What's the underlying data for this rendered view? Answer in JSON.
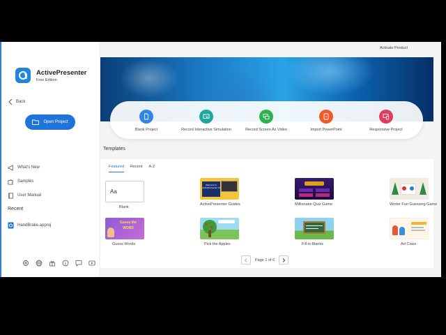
{
  "app": {
    "name": "ActivePresenter",
    "edition": "Free Edition",
    "activate": "Activate Product"
  },
  "sidebar": {
    "back": "Back",
    "open_project": "Open Project",
    "links": [
      {
        "label": "What's New",
        "icon": "megaphone-icon"
      },
      {
        "label": "Samples",
        "icon": "puzzle-icon"
      },
      {
        "label": "User Manual",
        "icon": "book-icon"
      }
    ],
    "recent_title": "Recent",
    "recent_items": [
      {
        "label": "HandBrake.approj",
        "icon": "project-file-icon"
      }
    ],
    "bottom_icons": [
      "settings-icon",
      "globe-icon",
      "gift-icon",
      "info-icon",
      "feedback-icon",
      "youtube-icon"
    ]
  },
  "actions": [
    {
      "label": "Blank Project",
      "color": "#2f86e4",
      "icon": "blank-file-icon"
    },
    {
      "label": "Record Interactive Simulation",
      "color": "#1fa8a0",
      "icon": "simulation-icon"
    },
    {
      "label": "Record Screen As Video",
      "color": "#2bb24c",
      "icon": "screen-record-icon"
    },
    {
      "label": "Import PowerPoint",
      "color": "#ef5a2a",
      "icon": "powerpoint-icon"
    },
    {
      "label": "Responsive Project",
      "color": "#e03d5e",
      "icon": "responsive-icon"
    }
  ],
  "templates": {
    "title": "Templates",
    "tabs": [
      {
        "label": "Featured",
        "active": true
      },
      {
        "label": "Recent",
        "active": false
      },
      {
        "label": "A-Z",
        "active": false
      }
    ],
    "blank_thumb_text": "Aa",
    "items": [
      {
        "name": "Blank"
      },
      {
        "name": "ActivePresenter Guides",
        "thumb_text": "Welcome to ActivePresenter 10"
      },
      {
        "name": "Millionaire Quiz Game"
      },
      {
        "name": "Winter Fun Guessing Game"
      },
      {
        "name": "Guess Words",
        "thumb_text": "Guess the WORD"
      },
      {
        "name": "Pick the Apples"
      },
      {
        "name": "Fill in Blanks"
      },
      {
        "name": "Art Class"
      }
    ],
    "pagination": "Page 1 of 6"
  }
}
